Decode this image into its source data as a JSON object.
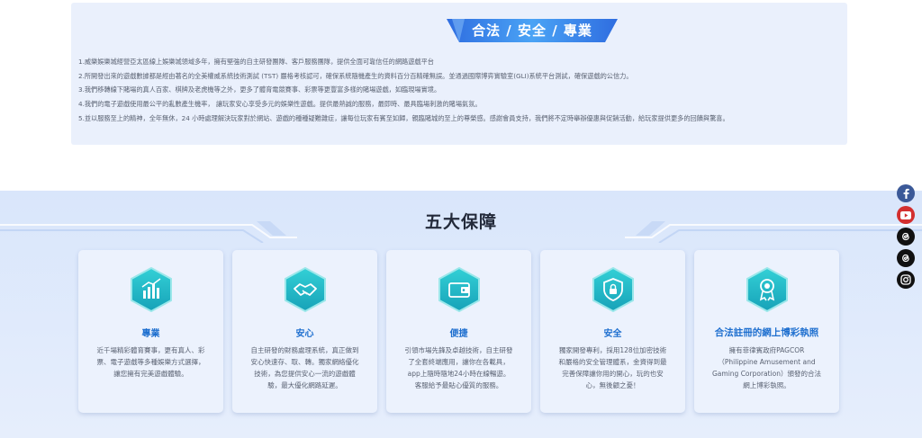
{
  "legal_section": {
    "heading": "合法 / 安全 / 專業",
    "items": [
      "1.威樂娛樂城經營亞太區線上娛樂城領域多年，擁有堅強的自主研發團隊、客戶服務團隊，提供全面可靠信任的網路遊戲平台",
      "2.所開發出來的遊戲數據都是經由著名的全美權威系統技術測試 (TST) 嚴格考核認可，確保系統隨機產生的資料百分百精確無誤。並通過國際博弈實驗室(GLI)系統平台測試，確保遊戲的公信力。",
      "3.我們移轉線下賭場的真人百家、棋牌及老虎機等之外，更多了體育電競賽事、彩票等更豐富多樣的賭場遊戲，如臨現場實境。",
      "4.我們的電子遊戲使用最公平的亂數產生機率， 讓玩家安心享受多元的娛樂性遊戲。提供最熱誠的服務，最即時、最具臨場刺激的賭場氣氛。",
      "5.並以服務至上的精神，全年無休，24 小時處理解決玩家對於網站、遊戲的種種疑難雜症，讓每位玩家有賓至如歸，親臨賭城的至上的尊榮感。感謝會員支持，我們將不定時舉辦優惠與促銷活動，給玩家提供更多的回饋與驚喜。"
    ]
  },
  "guarantee_section": {
    "title": "五大保障",
    "cards": [
      {
        "icon": "chart-bars-icon",
        "title": "專業",
        "desc": "近千場精彩體育賽事，更有真人、彩票、電子遊戲等多種娛樂方式選擇，讓您擁有完美遊戲體驗。"
      },
      {
        "icon": "handshake-icon",
        "title": "安心",
        "desc": "自主研發的財務處理系統，真正做到安心快速存、取、轉。獨家網絡優化技術，為您提供安心一流的遊戲體驗，最大優化網路延遲。"
      },
      {
        "icon": "wallet-icon",
        "title": "便捷",
        "desc": "引領市場先鋒及卓越技術，自主研發了全套終端應用，讓你在各載具，app上隨時隨地24小時在線暢遊。客服給予最貼心優質的服務。"
      },
      {
        "icon": "shield-lock-icon",
        "title": "安全",
        "desc": "獨家開發專利，採用128位加密技術和嚴格的安全管理體系，金資得到最完善保障讓你用的開心，玩的也安心，無後顧之憂！"
      },
      {
        "icon": "award-ribbon-icon",
        "title": "合法註冊的網上博彩執照",
        "desc": "擁有菲律賓政府PAGCOR（Philippine Amusement and Gaming Corporation）頒發的合法網上博彩執照。"
      }
    ]
  },
  "social": [
    {
      "name": "facebook-icon",
      "color": "#3b5998"
    },
    {
      "name": "youtube-icon",
      "color": "#d32f2f"
    },
    {
      "name": "threads-icon",
      "color": "#111111"
    },
    {
      "name": "threads-icon",
      "color": "#111111"
    },
    {
      "name": "instagram-icon",
      "color": "#111111"
    }
  ]
}
